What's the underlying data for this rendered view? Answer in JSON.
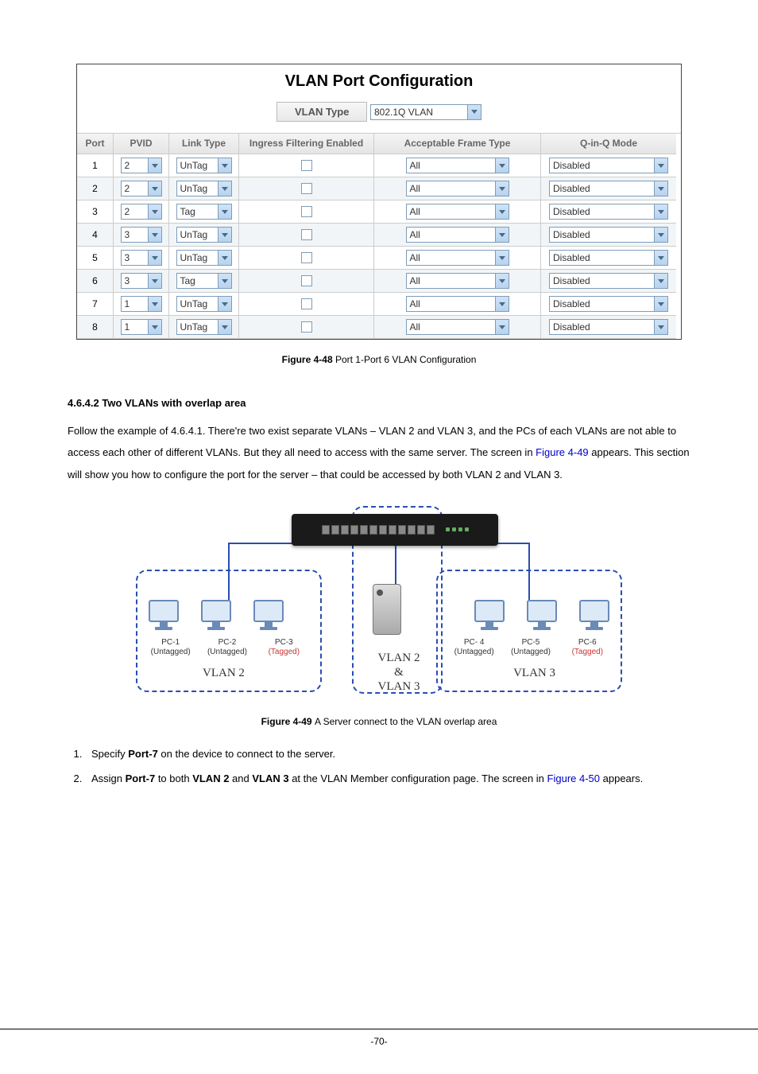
{
  "vlan_box": {
    "title": "VLAN Port Configuration",
    "type_label": "VLAN Type",
    "type_value": "802.1Q VLAN",
    "headers": [
      "Port",
      "PVID",
      "Link Type",
      "Ingress Filtering Enabled",
      "Acceptable Frame Type",
      "Q-in-Q Mode"
    ],
    "rows": [
      {
        "port": "1",
        "pvid": "2",
        "link": "UnTag",
        "aft": "All",
        "qinq": "Disabled",
        "alt": false
      },
      {
        "port": "2",
        "pvid": "2",
        "link": "UnTag",
        "aft": "All",
        "qinq": "Disabled",
        "alt": true
      },
      {
        "port": "3",
        "pvid": "2",
        "link": "Tag",
        "aft": "All",
        "qinq": "Disabled",
        "alt": false
      },
      {
        "port": "4",
        "pvid": "3",
        "link": "UnTag",
        "aft": "All",
        "qinq": "Disabled",
        "alt": true
      },
      {
        "port": "5",
        "pvid": "3",
        "link": "UnTag",
        "aft": "All",
        "qinq": "Disabled",
        "alt": false
      },
      {
        "port": "6",
        "pvid": "3",
        "link": "Tag",
        "aft": "All",
        "qinq": "Disabled",
        "alt": true
      },
      {
        "port": "7",
        "pvid": "1",
        "link": "UnTag",
        "aft": "All",
        "qinq": "Disabled",
        "alt": false
      },
      {
        "port": "8",
        "pvid": "1",
        "link": "UnTag",
        "aft": "All",
        "qinq": "Disabled",
        "alt": true
      }
    ]
  },
  "figure1_caption_prefix": "Figure 4-48 ",
  "figure1_caption": "Port 1-Port 6 VLAN Configuration",
  "subheading": "4.6.4.2 Two VLANs with overlap area",
  "para": {
    "t1": "Follow the example of  4.6.4.1. There're two exist separate VLANs – VLAN 2 and VLAN 3, and the PCs of each VLANs are not able to access each other of different VLANs. But they all need to access with the same server. The screen in ",
    "link1": "Figure 4-49",
    "t2": " appears. This section will show you how to configure the port for the server – that could be accessed by both VLAN 2 and VLAN 3."
  },
  "diagram": {
    "pcs_left": [
      {
        "name": "PC-1",
        "tag": "(Untagged)",
        "cls": ""
      },
      {
        "name": "PC-2",
        "tag": "(Untagged)",
        "cls": ""
      },
      {
        "name": "PC-3",
        "tag": "(Tagged)",
        "cls": "tagged"
      }
    ],
    "pcs_right": [
      {
        "name": "PC- 4",
        "tag": "(Untagged)",
        "cls": ""
      },
      {
        "name": "PC-5",
        "tag": "(Untagged)",
        "cls": ""
      },
      {
        "name": "PC-6",
        "tag": "(Tagged)",
        "cls": "tagged"
      }
    ],
    "vlan2": "VLAN 2",
    "vlan3": "VLAN 3",
    "vlan_mid_l1": "VLAN 2",
    "vlan_mid_amp": "&",
    "vlan_mid_l2": "VLAN 3"
  },
  "figure2_caption_prefix": "Figure 4-49 ",
  "figure2_caption": "A Server connect to the VLAN overlap area",
  "steps": {
    "s1a": "Specify ",
    "s1b": "Port-7",
    "s1c": " on the device to connect to the server.",
    "s2a": "Assign ",
    "s2b": "Port-7",
    "s2c": " to both ",
    "s2d": "VLAN 2",
    "s2e": " and ",
    "s2f": "VLAN 3",
    "s2g": " at the VLAN Member configuration page. The screen in ",
    "s2link": "Figure 4-50",
    "s2h": " appears."
  },
  "footer": "-70-"
}
